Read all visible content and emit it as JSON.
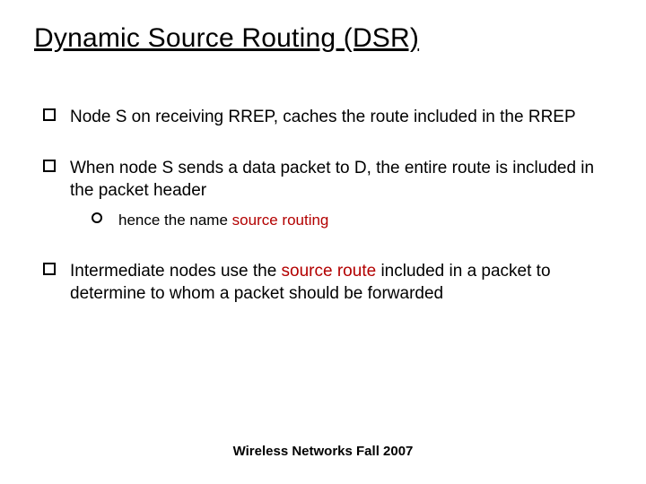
{
  "title": "Dynamic Source Routing (DSR)",
  "bullets": {
    "b1": "Node S on receiving RREP, caches the route included in the RREP",
    "b2": "When node S sends a data packet to D, the entire route is included in the packet header",
    "b2a_prefix": "hence the name ",
    "b2a_hl": "source routing",
    "b3_pre": "Intermediate nodes use the ",
    "b3_hl": "source route",
    "b3_post": " included in a packet to determine to whom a packet should be forwarded"
  },
  "footer": "Wireless Networks Fall 2007"
}
